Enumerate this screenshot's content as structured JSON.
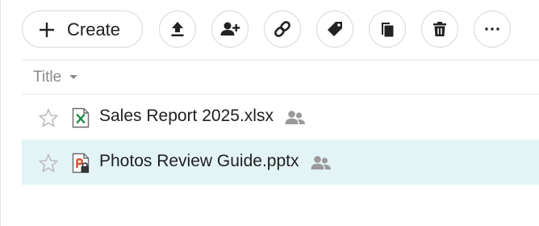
{
  "toolbar": {
    "create_label": "Create",
    "buttons": [
      {
        "name": "upload",
        "icon": "upload-icon"
      },
      {
        "name": "share-with-people",
        "icon": "add-person-icon"
      },
      {
        "name": "get-link",
        "icon": "link-icon"
      },
      {
        "name": "tag",
        "icon": "tag-icon"
      },
      {
        "name": "copy",
        "icon": "copy-icon"
      },
      {
        "name": "delete",
        "icon": "trash-icon"
      },
      {
        "name": "more",
        "icon": "more-horizontal-icon"
      }
    ]
  },
  "list": {
    "column_title": "Title",
    "rows": [
      {
        "name": "Sales Report 2025.xlsx",
        "type_icon": "excel-file-icon",
        "starred": false,
        "shared": true,
        "selected": false
      },
      {
        "name": "Photos Review Guide.pptx",
        "type_icon": "powerpoint-locked-file-icon",
        "starred": false,
        "shared": true,
        "selected": true
      }
    ]
  },
  "colors": {
    "border": "#d9d9d9",
    "icon": "#222222",
    "muted": "#8a8a8a",
    "selected_row": "#e3f4f7",
    "excel_green": "#1e8c45",
    "ppt_orange": "#d35230"
  }
}
